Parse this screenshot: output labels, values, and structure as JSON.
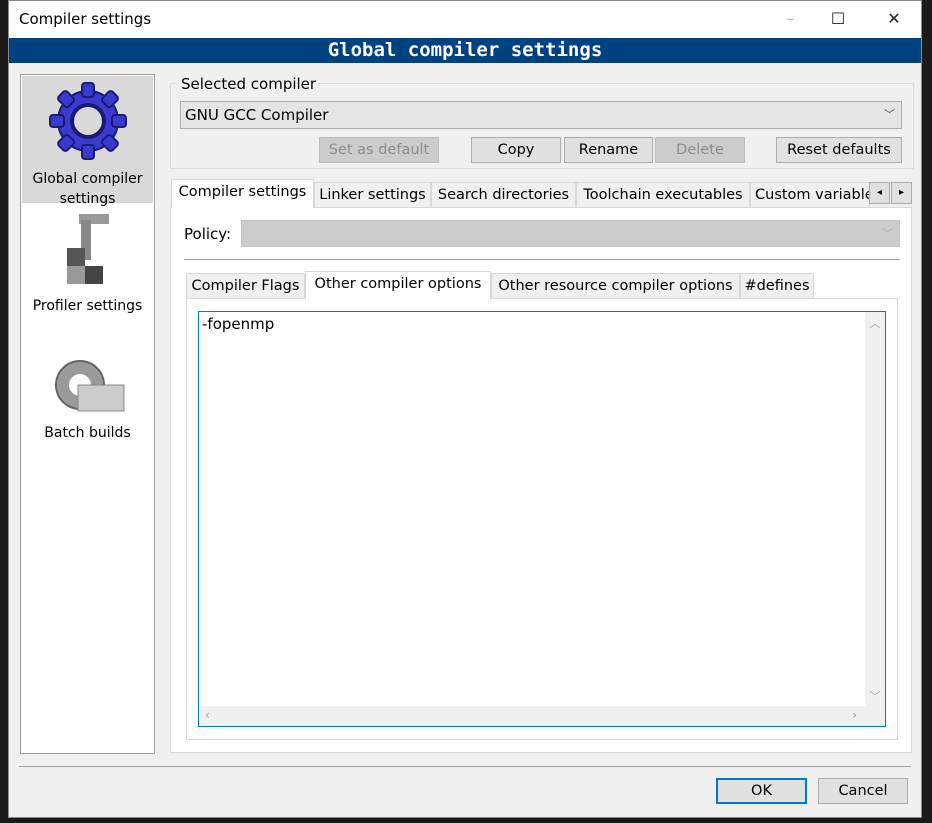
{
  "window": {
    "title": "Compiler settings",
    "minimize": "–",
    "maximize": "☐",
    "close": "✕"
  },
  "banner": "Global compiler settings",
  "sidebar": {
    "items": [
      {
        "label": "Global compiler settings",
        "icon": "blue-gear-icon",
        "selected": true
      },
      {
        "label": "Profiler settings",
        "icon": "caliper-blocks-icon"
      },
      {
        "label": "Batch builds",
        "icon": "gear-stack-icon"
      }
    ]
  },
  "selected_compiler": {
    "group_label": "Selected compiler",
    "value": "GNU GCC Compiler",
    "buttons": {
      "set_default": "Set as default",
      "copy": "Copy",
      "rename": "Rename",
      "delete": "Delete",
      "reset": "Reset defaults"
    }
  },
  "tabs": [
    {
      "label": "Compiler settings",
      "selected": true
    },
    {
      "label": "Linker settings"
    },
    {
      "label": "Search directories"
    },
    {
      "label": "Toolchain executables"
    },
    {
      "label": "Custom variables"
    }
  ],
  "tab_scroll": {
    "left": "◂",
    "right": "▸"
  },
  "policy": {
    "label": "Policy:",
    "value": ""
  },
  "inner_tabs": [
    {
      "label": "Compiler Flags"
    },
    {
      "label": "Other compiler options",
      "selected": true
    },
    {
      "label": "Other resource compiler options"
    },
    {
      "label": "#defines"
    }
  ],
  "editor": {
    "value": "-fopenmp"
  },
  "footer": {
    "ok": "OK",
    "cancel": "Cancel"
  }
}
